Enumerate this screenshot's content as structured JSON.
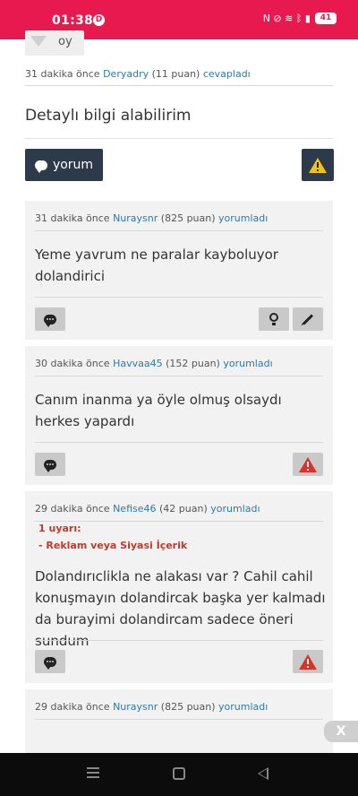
{
  "status_bar": {
    "time": "01:38",
    "notification_badge": "D",
    "icons_text": "N ⊘ ≋ ᛒ ▮",
    "battery": "41"
  },
  "top_vote": {
    "label": "oy"
  },
  "answer": {
    "meta": {
      "time": "31 dakika önce",
      "user": "Deryadry",
      "points": "(11 puan)",
      "action": "cevapladı"
    },
    "text": "Detaylı bilgi alabilirim",
    "comment_button": "yorum"
  },
  "comments": [
    {
      "time": "31 dakika önce",
      "user": "Nuraysnr",
      "points": "(825 puan)",
      "action": "yorumladı",
      "text": "Yeme yavrum ne paralar kayboluyor dolandirici"
    },
    {
      "time": "30 dakika önce",
      "user": "Havvaa45",
      "points": "(152 puan)",
      "action": "yorumladı",
      "text": "Canım inanma ya öyle olmuş olsaydı herkes yapardı"
    },
    {
      "time": "29 dakika önce",
      "user": "Nefise46",
      "points": "(42 puan)",
      "action": "yorumladı",
      "warning_title": "1 uyarı:",
      "warning_reason": "- Reklam veya Siyasi İçerik",
      "text": "Dolandırıclikla ne alakası var ? Cahil cahil konuşmayın dolandircak başka yer kalmadı da burayimi dolandircam sadece öneri sundum"
    },
    {
      "time": "29 dakika önce",
      "user": "Nuraysnr",
      "points": "(825 puan)",
      "action": "yorumladı"
    }
  ],
  "close_label": "X",
  "colors": {
    "status_bar": "#e8194f",
    "dark_button": "#2c3a4b",
    "link": "#2a7ab0",
    "warning_red": "#c0392b"
  }
}
